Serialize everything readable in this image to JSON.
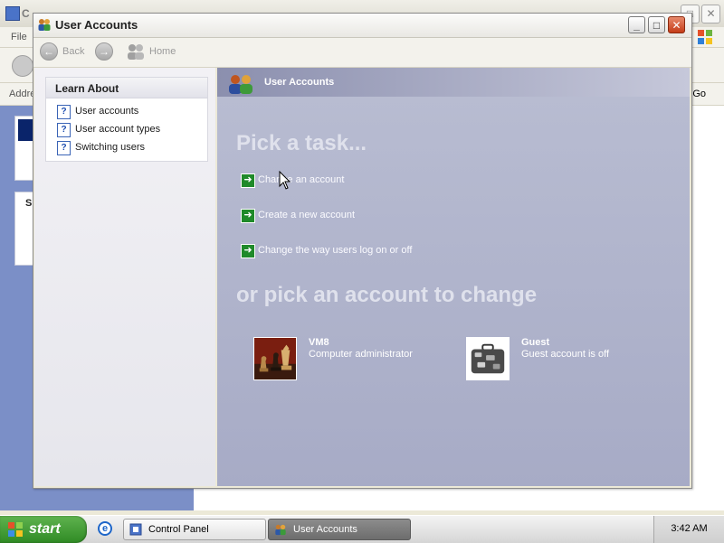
{
  "background_window": {
    "title": "C",
    "menu_file": "File",
    "address_label": "Addre",
    "go_label": "Go",
    "sidebar_letter": "S"
  },
  "window": {
    "title": "User Accounts",
    "controls": {
      "minimize": "_",
      "maximize": "□",
      "close": "✕"
    }
  },
  "nav": {
    "back_label": "Back",
    "home_label": "Home"
  },
  "learn_about": {
    "title": "Learn About",
    "items": [
      {
        "label": "User accounts"
      },
      {
        "label": "User account types"
      },
      {
        "label": "Switching users"
      }
    ]
  },
  "content": {
    "header_title": "User Accounts",
    "pick_task_heading": "Pick a task...",
    "tasks": [
      {
        "label": "Change an account"
      },
      {
        "label": "Create a new account"
      },
      {
        "label": "Change the way users log on or off"
      }
    ],
    "pick_account_heading": "or pick an account to change",
    "accounts": [
      {
        "name": "VM8",
        "description": "Computer administrator",
        "icon": "chess-pieces-icon"
      },
      {
        "name": "Guest",
        "description": "Guest account is off",
        "icon": "suitcase-icon"
      }
    ]
  },
  "taskbar": {
    "start_label": "start",
    "buttons": [
      {
        "label": "Control Panel",
        "active": false
      },
      {
        "label": "User Accounts",
        "active": true
      }
    ],
    "clock": "3:42 AM"
  },
  "colors": {
    "panel_accent": "#a9adc8",
    "task_arrow": "#1f8a2a",
    "start_green": "#3c9a30"
  }
}
